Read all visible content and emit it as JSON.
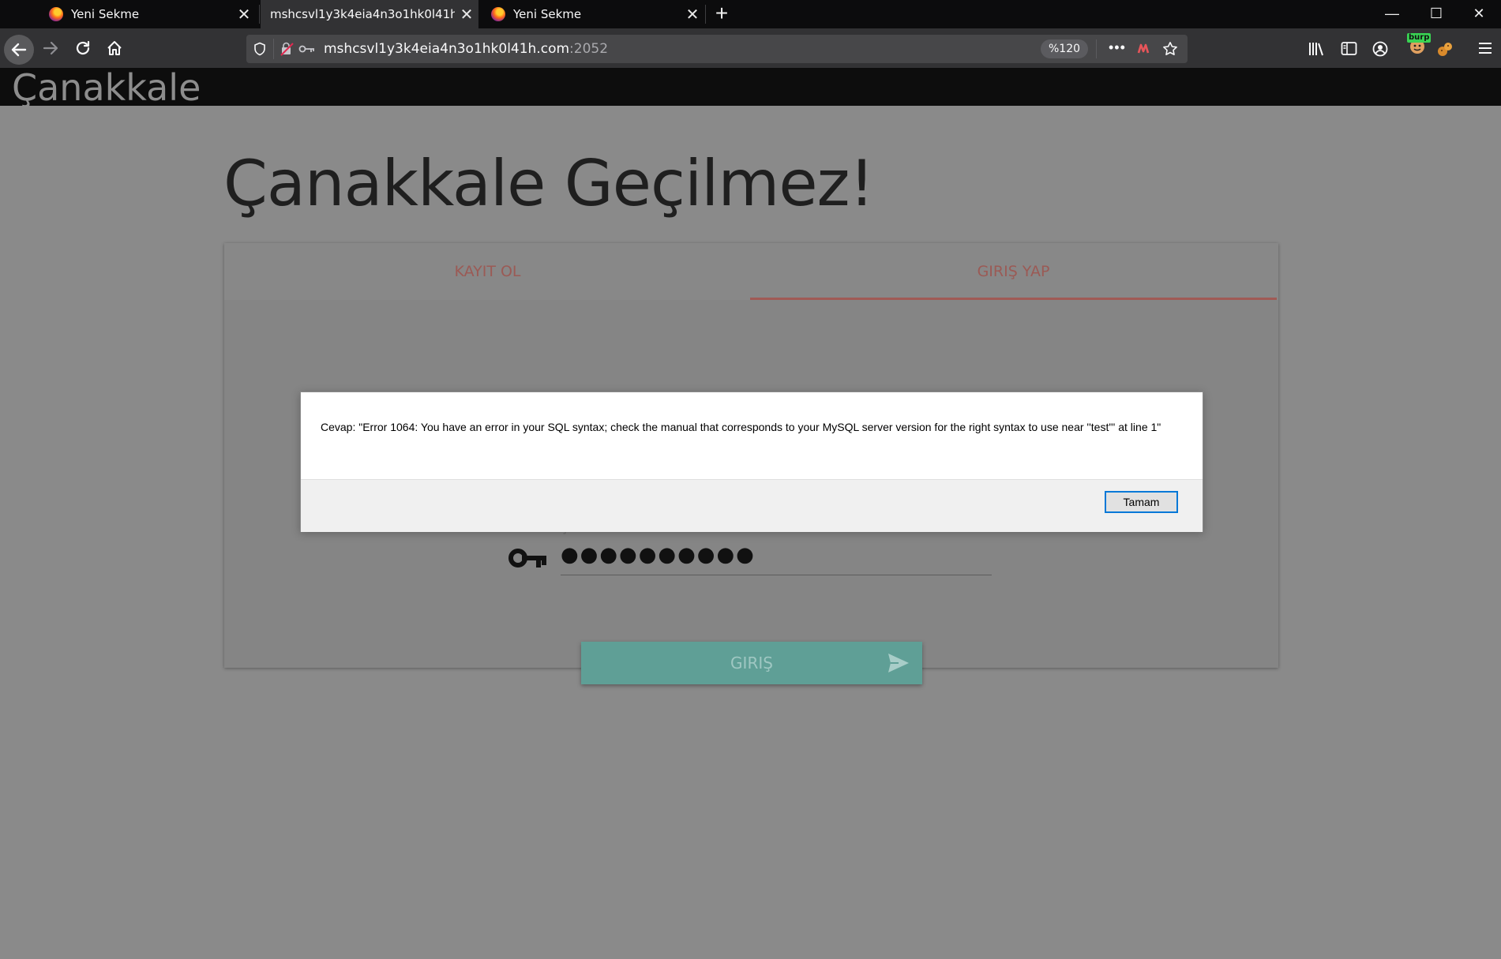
{
  "browser": {
    "tabs": [
      {
        "title": "Yeni Sekme"
      },
      {
        "title": "mshcsvl1y3k4eia4n3o1hk0l41h.com"
      },
      {
        "title": "Yeni Sekme"
      }
    ],
    "url_host": "mshcsvl1y3k4eia4n3o1hk0l41h.com",
    "url_port": ":2052",
    "zoom": "%120",
    "extension_badge": "burp"
  },
  "site": {
    "brand": "Çanakkale",
    "hero_title": "Çanakkale Geçilmez!",
    "tabs": {
      "register": "KAYIT OL",
      "login": "GIRIŞ YAP"
    },
    "password_label": "Şifre",
    "password_value": "●●●●●●●●●●",
    "submit_label": "GIRIŞ"
  },
  "dialog": {
    "message": "Cevap: \"Error 1064: You have an error in your SQL syntax; check the manual that corresponds to your MySQL server version for the right syntax to use near ''test''' at line 1\"",
    "ok_label": "Tamam"
  },
  "colors": {
    "accent_tab": "#a05a55",
    "submit_button": "#5f9f96",
    "dialog_focus": "#0078d7"
  }
}
